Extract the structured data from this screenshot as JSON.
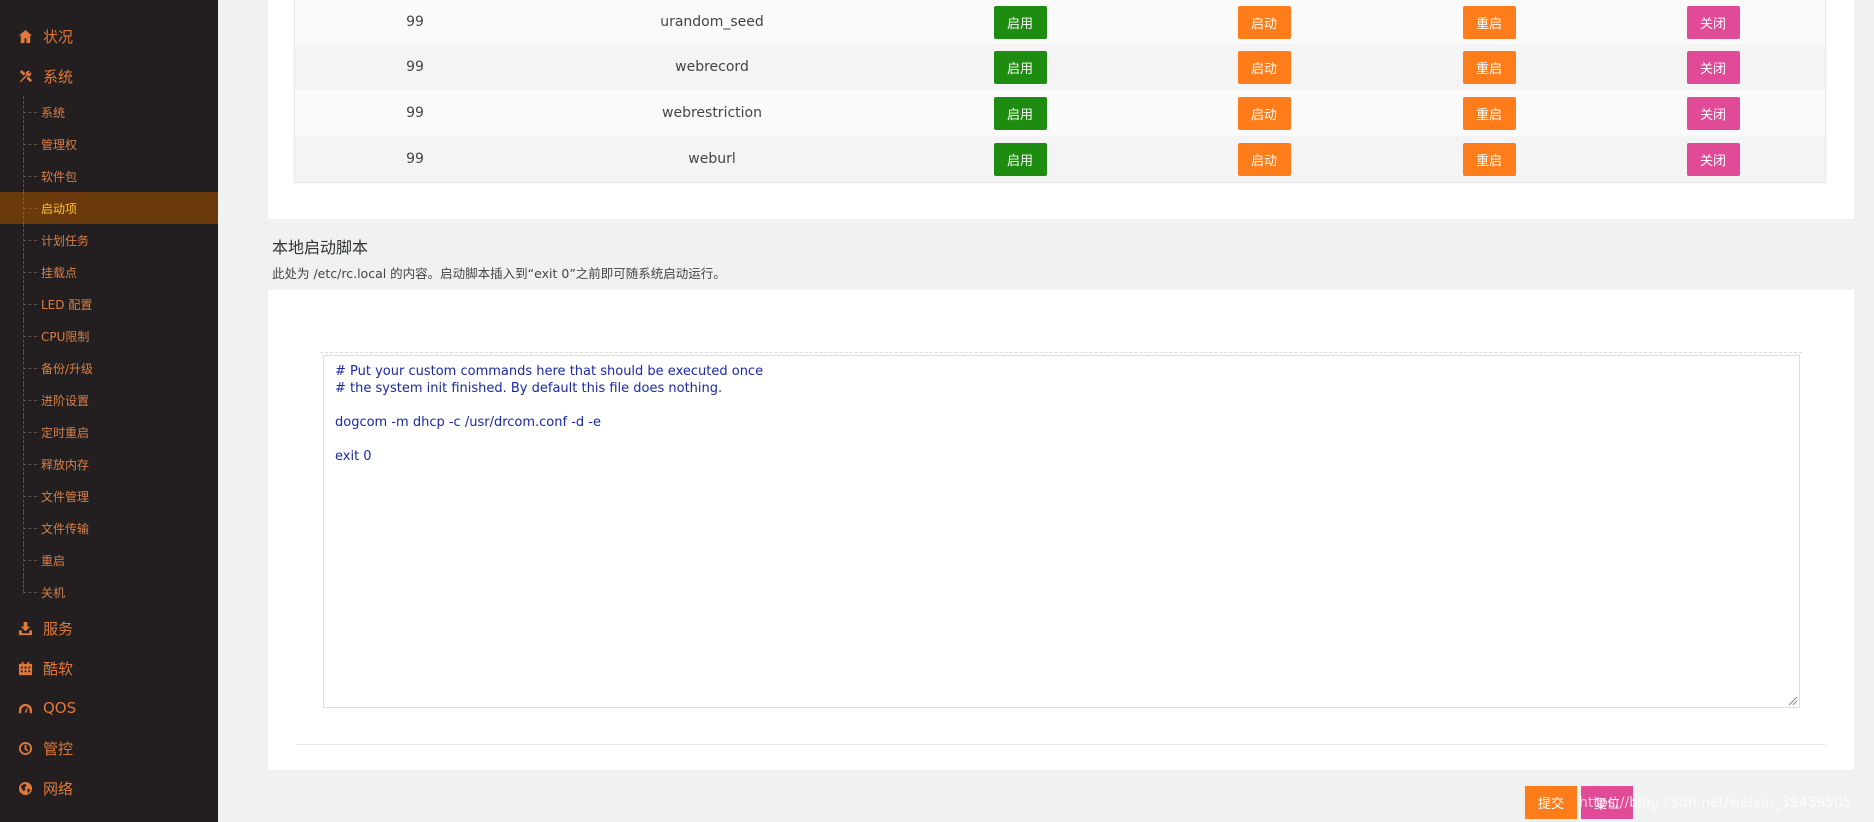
{
  "sidebar": {
    "sections": [
      {
        "label": "状况",
        "icon": "home-icon"
      },
      {
        "label": "系统",
        "icon": "tools-icon"
      }
    ],
    "sub_items": [
      "系统",
      "管理权",
      "软件包",
      "启动项",
      "计划任务",
      "挂载点",
      "LED 配置",
      "CPU限制",
      "备份/升级",
      "进阶设置",
      "定时重启",
      "释放内存",
      "文件管理",
      "文件传输",
      "重启",
      "关机"
    ],
    "active_index": 3,
    "bottom_sections": [
      {
        "label": "服务",
        "icon": "download-icon"
      },
      {
        "label": "酷软",
        "icon": "calendar-icon"
      },
      {
        "label": "QOS",
        "icon": "gauge-icon"
      },
      {
        "label": "管控",
        "icon": "clock-icon"
      },
      {
        "label": "网络",
        "icon": "globe-icon"
      }
    ]
  },
  "startup_table": {
    "rows": [
      {
        "priority": "99",
        "name": "urandom_seed"
      },
      {
        "priority": "99",
        "name": "webrecord"
      },
      {
        "priority": "99",
        "name": "webrestriction"
      },
      {
        "priority": "99",
        "name": "weburl"
      }
    ],
    "buttons": {
      "enable": "启用",
      "start": "启动",
      "restart": "重启",
      "stop": "关闭"
    },
    "colors": {
      "enable": "#1e8c10",
      "start": "#ff7c1a",
      "restart": "#ff7c1a",
      "stop": "#e04a97"
    }
  },
  "local_script": {
    "title": "本地启动脚本",
    "description": "此处为 /etc/rc.local 的内容。启动脚本插入到“exit 0”之前即可随系统启动运行。",
    "content": "# Put your custom commands here that should be executed once\n# the system init finished. By default this file does nothing.\n\ndogcom -m dhcp -c /usr/drcom.conf -d -e\n\nexit 0"
  },
  "footer": {
    "submit_label": "提交",
    "reset_label": "复位",
    "watermark": "https://blog.csdn.net/weixin_39439505"
  }
}
